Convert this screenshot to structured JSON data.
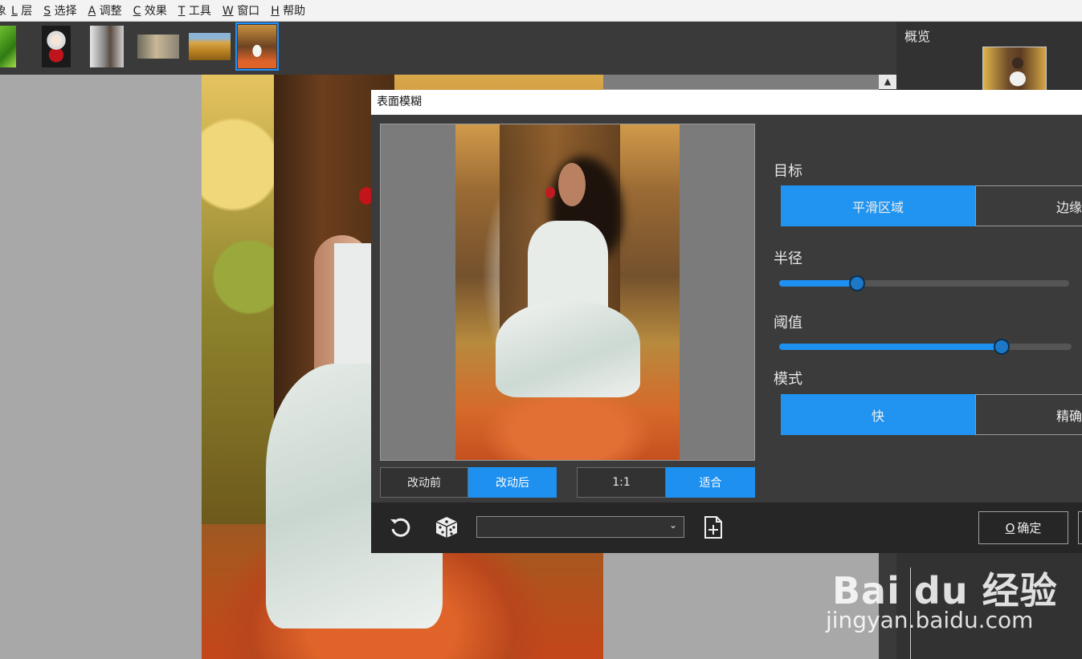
{
  "menu": {
    "first_partial": "象",
    "items": [
      {
        "key": "L",
        "label": "层"
      },
      {
        "key": "S",
        "label": "选择"
      },
      {
        "key": "A",
        "label": "调整"
      },
      {
        "key": "C",
        "label": "效果"
      },
      {
        "key": "T",
        "label": "工具"
      },
      {
        "key": "W",
        "label": "窗口"
      },
      {
        "key": "H",
        "label": "帮助"
      }
    ]
  },
  "right_panel": {
    "title": "概览"
  },
  "dialog": {
    "title": "表面模糊",
    "preview_toggle": {
      "before": "改动前",
      "after": "改动后",
      "active": "after"
    },
    "zoom_toggle": {
      "actual": "1:1",
      "fit": "适合",
      "active": "fit"
    },
    "target": {
      "label": "目标",
      "options": [
        "平滑区域",
        "边缘"
      ],
      "selected": "平滑区域"
    },
    "radius": {
      "label": "半径",
      "value_fraction": 0.27
    },
    "threshold": {
      "label": "阈值",
      "value_fraction": 0.76
    },
    "mode": {
      "label": "模式",
      "options": [
        "快",
        "精确"
      ],
      "selected": "快"
    },
    "preset_select": {
      "value": ""
    },
    "ok": {
      "key": "O",
      "label": "确定"
    }
  },
  "watermark": {
    "logo": "Bai du 经验",
    "url": "jingyan.baidu.com"
  },
  "colors": {
    "accent": "#1e90f0",
    "dialog_bg": "#3b3b3b",
    "toolbar_bg": "#262626"
  }
}
